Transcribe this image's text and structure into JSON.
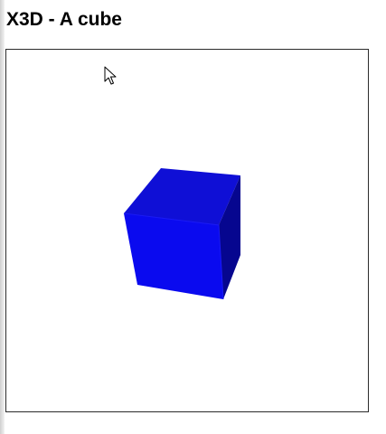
{
  "page": {
    "title": "X3D - A cube"
  },
  "viewer": {
    "background": "#ffffff",
    "cursor_icon": "arrow-cursor-icon",
    "object": {
      "type": "box",
      "material_color": "#0000ff",
      "front_face_color": "#0a0aef",
      "top_face_color": "#0f0fd6",
      "side_face_color": "#06068f"
    }
  }
}
